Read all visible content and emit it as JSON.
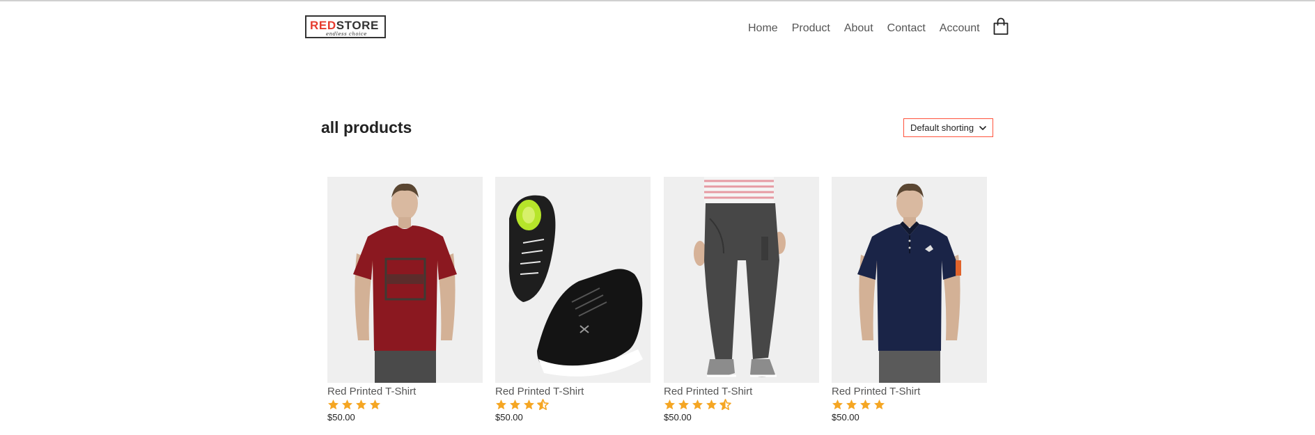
{
  "header": {
    "logo": {
      "brand_red": "RED",
      "brand_dark": "STORE",
      "tagline": "endless choice"
    },
    "nav": [
      "Home",
      "Product",
      "About",
      "Contact",
      "Account"
    ],
    "cart_icon": "shopping-bag-icon"
  },
  "main": {
    "title": "all products",
    "sort": {
      "selected": "Default shorting"
    }
  },
  "products": [
    {
      "name": "Red Printed T-Shirt",
      "price": "$50.00",
      "rating": 4,
      "image": "red-tshirt-model"
    },
    {
      "name": "Red Printed T-Shirt",
      "price": "$50.00",
      "rating": 3.5,
      "image": "black-sneakers"
    },
    {
      "name": "Red Printed T-Shirt",
      "price": "$50.00",
      "rating": 4.5,
      "image": "grey-jogger-pants"
    },
    {
      "name": "Red Printed T-Shirt",
      "price": "$50.00",
      "rating": 4,
      "image": "navy-polo-model"
    }
  ],
  "colors": {
    "accent": "#ff523b",
    "star": "#f5a623",
    "text": "#555555",
    "image_bg": "#efefef"
  }
}
